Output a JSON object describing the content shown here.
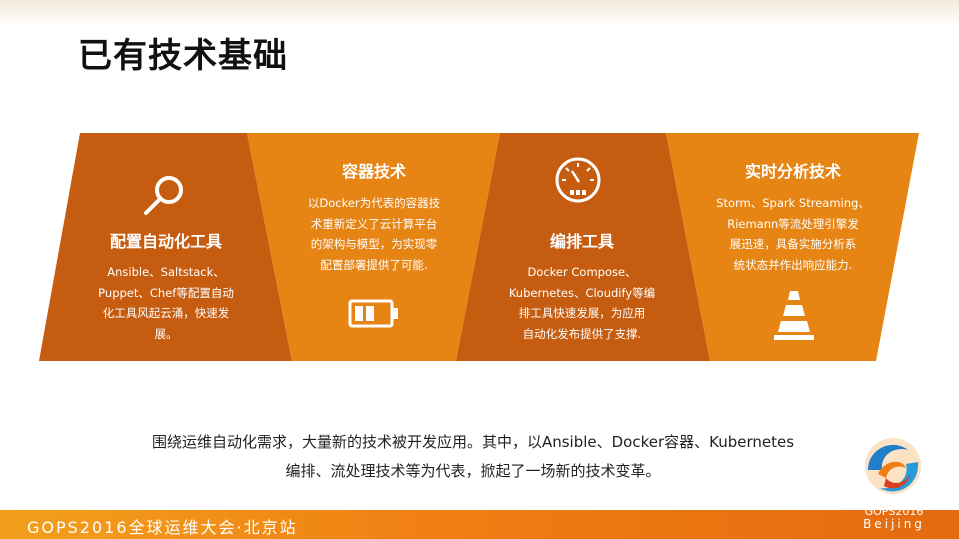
{
  "slide": {
    "title": "已有技术基础",
    "summary_line1": "围绕运维自动化需求，大量新的技术被开发应用。其中，以Ansible、Docker容器、Kubernetes",
    "summary_line2": "编排、流处理技术等为代表，掀起了一场新的技术变革。"
  },
  "panels": [
    {
      "title": "配置自动化工具",
      "body": [
        "Ansible、Saltstack、",
        "Puppet、Chef等配置自动",
        "化工具风起云涌，快速发",
        "展。"
      ],
      "icon": "magnifier-icon",
      "color": "#c65c10"
    },
    {
      "title": "容器技术",
      "body": [
        "以Docker为代表的容器技",
        "术重新定义了云计算平台",
        "的架构与模型，为实现零",
        "配置部署提供了可能."
      ],
      "icon": "battery-icon",
      "color": "#e68414"
    },
    {
      "title": "编排工具",
      "body": [
        "Docker Compose、",
        "Kubernetes、Cloudify等编",
        "排工具快速发展，为应用",
        "自动化发布提供了支撑."
      ],
      "icon": "gauge-icon",
      "color": "#c65c10"
    },
    {
      "title": "实时分析技术",
      "body": [
        "Storm、Spark Streaming、",
        "Riemann等流处理引擎发",
        "展迅速，具备实施分析系",
        "统状态并作出响应能力."
      ],
      "icon": "traffic-cone-icon",
      "color": "#e68414"
    }
  ],
  "footer": {
    "text": "GOPS2016全球运维大会·北京站",
    "logo_line1": "GOPS2016",
    "logo_line2": "Beijing"
  }
}
